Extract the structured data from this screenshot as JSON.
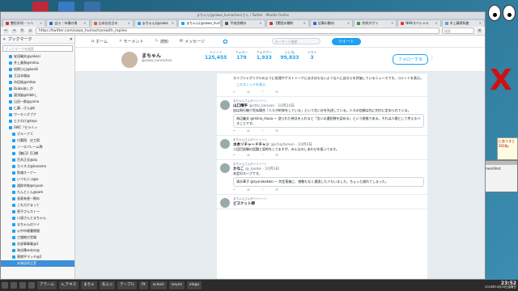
{
  "window": {
    "title": "まちゃん(@sawa_humachan)さん / Twitter - Mozilla Firefox"
  },
  "tabs": [
    {
      "label": "整形外科・リハ"
    },
    {
      "label": "吉川｜市場の現"
    },
    {
      "label": "山本弘在日の"
    },
    {
      "label": "まちゃん(@sawa"
    },
    {
      "label": "まちゃん(@sawa_huma"
    },
    {
      "label": "平成合戦の"
    },
    {
      "label": "【関西の鯖町"
    },
    {
      "label": "記事の動向"
    },
    {
      "label": "余命がグリ"
    },
    {
      "label": "NHKスペシャル"
    },
    {
      "label": "木上藤探知産"
    }
  ],
  "toolbar": {
    "url": "https://twitter.com/sawa_humachan/with_replies",
    "search_placeholder": "検索"
  },
  "sidebar": {
    "title": "ブックマーク",
    "search_placeholder": "ブックマークを検索",
    "items": [
      "安田磯夫@yakasi",
      "井上美和@mitsu",
      "紹際小山@koshi",
      "王洁本傑@",
      "市田裕@mtkw",
      "Dubaiあしが",
      "湯浅誠@hibiki_",
      "山田一郎@yama",
      "仁藤…さん@k",
      "ワーキングプア",
      "とりわけ@toyo",
      "SWC「セラミッ",
      "グループ C",
      "付葉翔　庄工宿",
      "ノースバレーム隊",
      "【編日】【日橋",
      "百木正志@zq",
      "カリネズ@kanamo",
      "魚魂オーナー",
      "いつもニコ@o",
      "遠辟木純@nyuan",
      "たんとくん@sam",
      "長尾有香一期め",
      "これだけまって",
      "恵子さんストー",
      "川淵さんとまちゃん",
      "まちゃんのツイ",
      "公中市廃書期間",
      "工間樹方営場",
      "お部事事業@2",
      "海谷穂みめの@",
      "黒燃平マッチ@2",
      "水海谷尚之宮"
    ],
    "selected_index": 32
  },
  "twitter": {
    "nav": [
      "ホーム",
      "モーメント",
      "通知",
      "メッセージ"
    ],
    "search_placeholder": "キーワード検索",
    "tweet_button": "ツイート",
    "profile": {
      "name": "まちゃん",
      "handle": "@sawa_humachan"
    },
    "stats": [
      {
        "label": "ツイート",
        "value": "125,455"
      },
      {
        "label": "フォロー",
        "value": "179"
      },
      {
        "label": "フォロワー",
        "value": "1,933"
      },
      {
        "label": "いいね",
        "value": "99,833"
      },
      {
        "label": "リスト",
        "value": "3"
      }
    ],
    "follow_button": "フォローする",
    "tweets": [
      {
        "rt": "",
        "name": "",
        "handle": "",
        "text": "スイブジャグリアルのように処理やゲストトークにはきはもないような人に自分らを評価しているニュースです。コメントを表示。",
        "quote": "",
        "link": "このスレッドを表示"
      },
      {
        "rt": "まちゃんさんがリツイート",
        "name": "山口晴平 ",
        "handle": "@ctto_kensen · 10月24日",
        "text": "加は飛行機で死ぬ場合「人々が約束をしている」という言い分を先述している。人々の信頼は先に何かに定められている。",
        "quote": "海辺義文 @mikio_masa — 造られた視点を入れると「言いの選択肢を認める」という根拠である。それは人間として考えるべきことです。",
        "link": ""
      },
      {
        "rt": "まちゃんさんがリツイート",
        "name": "水本リチャードチャン ",
        "handle": "@ichiyfamen · 10月4日",
        "text": "二回目試験の話題と契約をしてますが、みんなのしあわせを祖ってます。",
        "quote": "",
        "link": ""
      },
      {
        "rt": "まちゃんさんがリツイート",
        "name": "かなこ ",
        "handle": "@_kaoke · 10月3日",
        "text": "未定のスープです。",
        "quote": "清水華子 @zyuniwakaki — 判定直後に、感動もなく通過した人もいました。ちょっと崩れてしまった。",
        "link": ""
      },
      {
        "rt": "まちゃんさんがリツイート",
        "name": "ビスケット師 ",
        "handle": "",
        "text": "",
        "quote": "",
        "link": ""
      }
    ]
  },
  "desktop": {
    "sticky_text": "にあうきじ 2018y",
    "panel_text": "screenShot"
  },
  "taskbar": {
    "items": [
      "アラーム",
      "e_テキス",
      "まちゃ",
      "あふっ",
      "テーブル",
      "fit",
      "xclock",
      "xeyes",
      "xlogo"
    ],
    "time": "23:52",
    "date": "2018年10月26日金曜日"
  },
  "colors": {
    "accent": "#1da1f2",
    "selected": "#3d8fd6",
    "close_mark": "#d01010"
  }
}
